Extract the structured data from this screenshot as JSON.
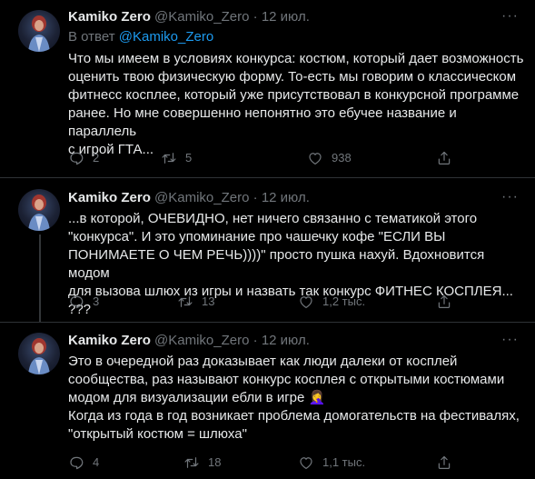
{
  "tweets": [
    {
      "name": "Kamiko Zero",
      "handle": "@Kamiko_Zero",
      "dot": "·",
      "date": "12 июл.",
      "reply_prefix": "В ответ",
      "reply_mention": "@Kamiko_Zero",
      "text": "Что мы имеем в условиях конкурса: костюм, который дает возможность\nоценить твою физическую форму. То-есть мы говорим о классическом\nфитнесс косплее, который уже присутствовал в конкурсной программе\nранее. Но мне совершенно непонятно это ебучее название и параллель\nс игрой ГТА...",
      "replies": "2",
      "retweets": "5",
      "likes": "938"
    },
    {
      "name": "Kamiko Zero",
      "handle": "@Kamiko_Zero",
      "dot": "·",
      "date": "12 июл.",
      "text": "...в которой, ОЧЕВИДНО, нет ничего связанно с тематикой этого\n\"конкурса\". И это упоминание про чашечку кофе \"ЕСЛИ ВЫ\nПОНИМАЕТЕ О ЧЕМ РЕЧЬ))))\" просто пушка нахуй. Вдохновится модом\nдля вызова шлюх из игры и назвать так конкурс ФИТНЕС КОСПЛЕЯ... ???",
      "replies": "3",
      "retweets": "13",
      "likes": "1,2 тыс."
    },
    {
      "name": "Kamiko Zero",
      "handle": "@Kamiko_Zero",
      "dot": "·",
      "date": "12 июл.",
      "text": "Это в очередной раз доказывает как люди далеки от косплей\nсообщества, раз называют конкурс косплея с открытыми костюмами\nмодом для визуализации ебли в игре 🤦‍♀️\nКогда из года в год возникает проблема домогательств на фестивалях,\n\"открытый костюм = шлюха\"",
      "replies": "4",
      "retweets": "18",
      "likes": "1,1 тыс."
    }
  ],
  "more_label": "···",
  "colors": {
    "background": "#000000",
    "text": "#e7e9ea",
    "muted": "#71767b",
    "link": "#1d9bf0",
    "divider": "#2f3336"
  },
  "icons": [
    "reply-icon",
    "retweet-icon",
    "like-icon",
    "share-icon",
    "more-icon"
  ]
}
